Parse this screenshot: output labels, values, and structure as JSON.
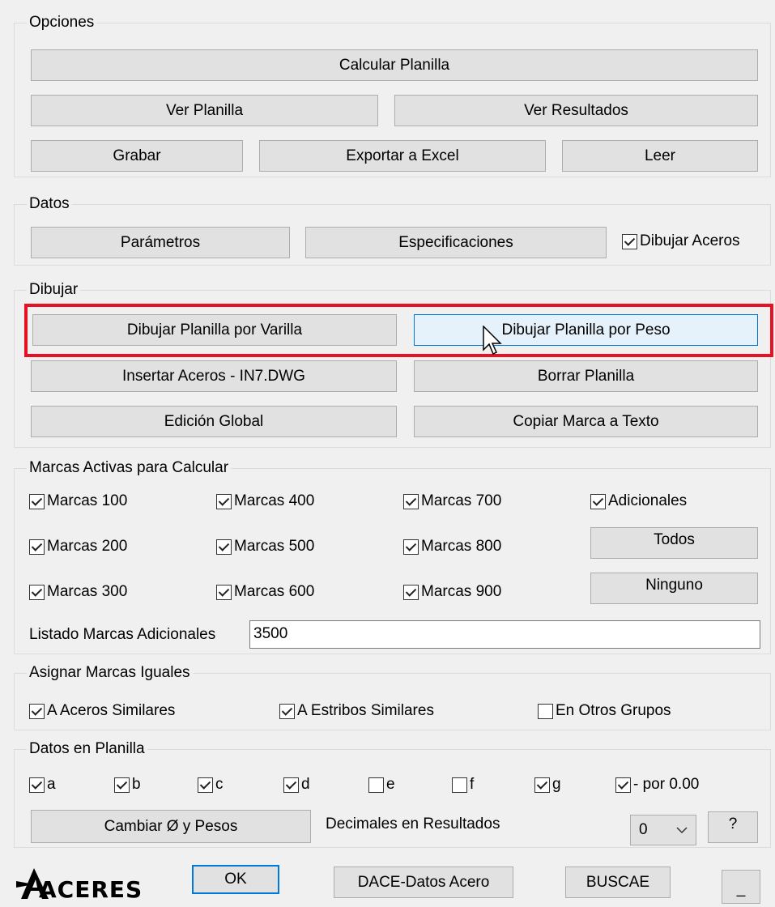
{
  "opciones": {
    "title": "Opciones",
    "calcular_planilla": "Calcular Planilla",
    "ver_planilla": "Ver Planilla",
    "ver_resultados": "Ver Resultados",
    "grabar": "Grabar",
    "exportar_excel": "Exportar a Excel",
    "leer": "Leer"
  },
  "datos": {
    "title": "Datos",
    "parametros": "Parámetros",
    "especificaciones": "Especificaciones",
    "dibujar_aceros": {
      "label": "Dibujar Aceros",
      "checked": true
    }
  },
  "dibujar": {
    "title": "Dibujar",
    "por_varilla": "Dibujar Planilla por Varilla",
    "por_peso": "Dibujar Planilla por Peso",
    "insertar_aceros": "Insertar Aceros - IN7.DWG",
    "borrar_planilla": "Borrar Planilla",
    "edicion_global": "Edición Global",
    "copiar_marca": "Copiar Marca a Texto"
  },
  "marcas": {
    "title": "Marcas Activas para Calcular",
    "m100": "Marcas 100",
    "m200": "Marcas 200",
    "m300": "Marcas 300",
    "m400": "Marcas 400",
    "m500": "Marcas 500",
    "m600": "Marcas 600",
    "m700": "Marcas 700",
    "m800": "Marcas 800",
    "m900": "Marcas 900",
    "adicionales": "Adicionales",
    "todos": "Todos",
    "ninguno": "Ninguno",
    "listado_label": "Listado Marcas Adicionales",
    "listado_value": "3500"
  },
  "asignar": {
    "title": "Asignar Marcas Iguales",
    "aceros_similares": "A Aceros Similares",
    "estribos_similares": "A Estribos Similares",
    "otros_grupos": "En Otros Grupos"
  },
  "planilla": {
    "title": "Datos en Planilla",
    "a": "a",
    "b": "b",
    "c": "c",
    "d": "d",
    "e": "e",
    "f": "f",
    "g": "g",
    "por": "- por 0.00",
    "cambiar": "Cambiar Ø y Pesos",
    "decimales_label": "Decimales en Resultados",
    "decimales_value": "0",
    "help": "?"
  },
  "footer": {
    "logo_text": "ACERES",
    "ok": "OK",
    "dace": "DACE-Datos Acero",
    "buscae": "BUSCAE",
    "minimize": "_"
  }
}
